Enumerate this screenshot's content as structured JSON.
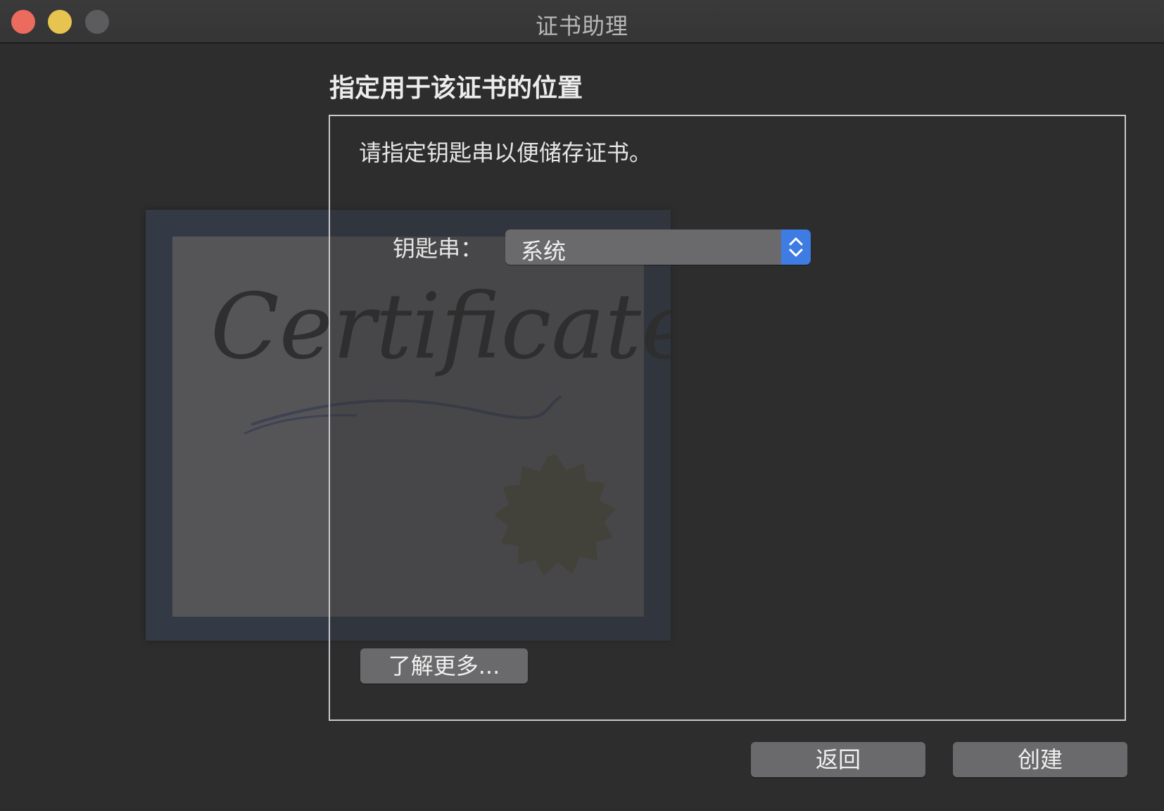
{
  "window": {
    "title": "证书助理",
    "controls": [
      "close-button",
      "minimize-button",
      "zoom-button"
    ]
  },
  "illustration": {
    "word": "Certificate",
    "icon": "certificate-icon"
  },
  "main": {
    "heading": "指定用于该证书的位置",
    "instruction": "请指定钥匙串以便储存证书。",
    "keychain_label": "钥匙串：",
    "keychain_value": "系统",
    "learn_more_label": "了解更多..."
  },
  "footer": {
    "back_label": "返回",
    "create_label": "创建"
  },
  "colors": {
    "close": "#ec6b5f",
    "minimize": "#e7c44f",
    "zoom_disabled": "#5c5c5e",
    "accent": "#3e7be3"
  }
}
